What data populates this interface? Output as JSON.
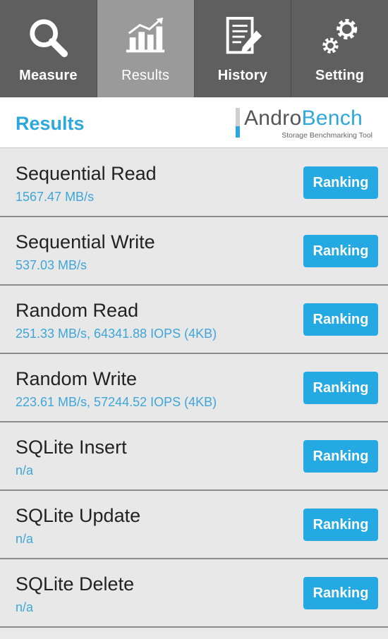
{
  "tabs": [
    {
      "label": "Measure",
      "icon": "magnifier-icon",
      "active": false
    },
    {
      "label": "Results",
      "icon": "bar-chart-icon",
      "active": true
    },
    {
      "label": "History",
      "icon": "document-pen-icon",
      "active": false
    },
    {
      "label": "Setting",
      "icon": "gears-icon",
      "active": false
    }
  ],
  "header": {
    "title": "Results",
    "logo_andro": "Andro",
    "logo_bench": "Bench",
    "logo_tagline": "Storage Benchmarking Tool"
  },
  "results": [
    {
      "name": "Sequential Read",
      "value": "1567.47 MB/s",
      "button": "Ranking"
    },
    {
      "name": "Sequential Write",
      "value": "537.03 MB/s",
      "button": "Ranking"
    },
    {
      "name": "Random Read",
      "value": "251.33 MB/s, 64341.88 IOPS (4KB)",
      "button": "Ranking"
    },
    {
      "name": "Random Write",
      "value": "223.61 MB/s, 57244.52 IOPS (4KB)",
      "button": "Ranking"
    },
    {
      "name": "SQLite Insert",
      "value": "n/a",
      "button": "Ranking"
    },
    {
      "name": "SQLite Update",
      "value": "n/a",
      "button": "Ranking"
    },
    {
      "name": "SQLite Delete",
      "value": "n/a",
      "button": "Ranking"
    }
  ],
  "colors": {
    "accent": "#2ea8dc",
    "button": "#24a9e3",
    "tab_bg": "#5f5f5f",
    "tab_active_bg": "#9a9a9a",
    "row_bg": "#e8e8e8"
  }
}
